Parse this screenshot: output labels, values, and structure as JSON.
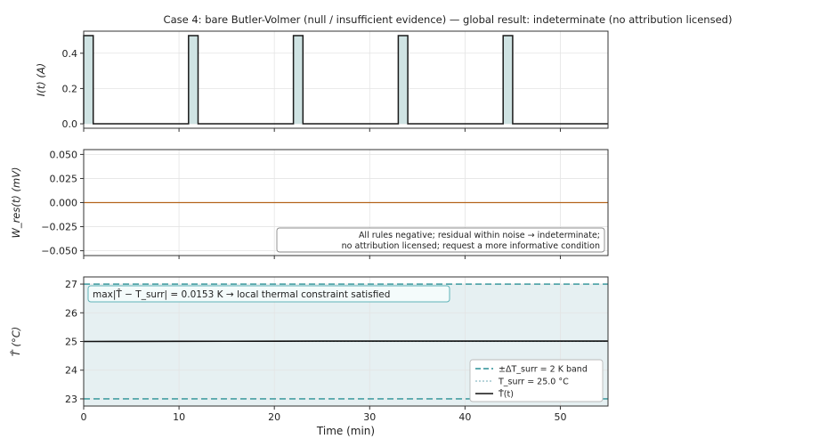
{
  "figure_title": "Case 4: bare Butler-Volmer (null / insufficient evidence)  —  global result: indeterminate (no attribution licensed)",
  "colors": {
    "current_line": "#1a1a1a",
    "current_fill": "#cfe3e3",
    "residual_line": "#b5651d",
    "band_fill": "#e6f0f2",
    "band_edge": "#2a8f95",
    "t_surr_line": "#6fa8b5",
    "temperature_line": "#111111",
    "annotation_edge": "#5fb3b8",
    "annotation_text": "#2a8f95"
  },
  "chart_data": [
    {
      "type": "area",
      "ylabel": "I(t) (A)",
      "xlim": [
        0,
        55
      ],
      "ylim": [
        -0.025,
        0.525
      ],
      "yticks": [
        0.0,
        0.2,
        0.4
      ],
      "ytick_labels": [
        "0.0",
        "0.2",
        "0.4"
      ],
      "xticks": [
        0,
        10,
        20,
        30,
        40,
        50
      ],
      "grid": true,
      "pulses": [
        {
          "start": 0.0,
          "end": 1.0
        },
        {
          "start": 11.0,
          "end": 12.0
        },
        {
          "start": 22.0,
          "end": 23.0
        },
        {
          "start": 33.0,
          "end": 34.0
        },
        {
          "start": 44.0,
          "end": 45.0
        }
      ],
      "pulse_amplitude": 0.5,
      "baseline": 0.0
    },
    {
      "type": "line",
      "ylabel": "W_res(t) (mV)",
      "xlim": [
        0,
        55
      ],
      "ylim": [
        -0.055,
        0.055
      ],
      "yticks": [
        0.05,
        0.025,
        0.0,
        -0.025,
        -0.05
      ],
      "ytick_labels": [
        "0.050",
        "0.025",
        "0.000",
        "−0.025",
        "−0.050"
      ],
      "xticks": [
        0,
        10,
        20,
        30,
        40,
        50
      ],
      "grid": true,
      "series": [
        {
          "x": [
            0,
            55
          ],
          "y": [
            0.0,
            0.0
          ]
        }
      ],
      "annotation": [
        "All rules negative; residual within noise → indeterminate;",
        "no attribution licensed; request a more informative condition"
      ]
    },
    {
      "type": "line",
      "ylabel": "T̂ (°C)",
      "xlabel": "Time (min)",
      "xlim": [
        0,
        55
      ],
      "ylim": [
        22.75,
        27.25
      ],
      "yticks": [
        23,
        24,
        25,
        26,
        27
      ],
      "ytick_labels": [
        "23",
        "24",
        "25",
        "26",
        "27"
      ],
      "xticks": [
        0,
        10,
        20,
        30,
        40,
        50
      ],
      "xtick_labels": [
        "0",
        "10",
        "20",
        "30",
        "40",
        "50"
      ],
      "grid": true,
      "band": [
        23.0,
        27.0
      ],
      "t_surr": 25.0,
      "series": [
        {
          "name": "T̂(t)",
          "x": [
            0,
            5,
            10,
            15,
            20,
            25,
            30,
            35,
            40,
            45,
            50,
            55
          ],
          "y": [
            25.0,
            25.002,
            25.005,
            25.008,
            25.011,
            25.013,
            25.014,
            25.015,
            25.015,
            25.015,
            25.014,
            25.013
          ]
        }
      ],
      "annotation": "max|T̂ − T_surr| = 0.0153 K  →  local thermal constraint satisfied",
      "legend": {
        "placement": "lower-right",
        "entries": [
          "±ΔT_surr = 2 K band",
          "T_surr = 25.0 °C",
          "T̂(t)"
        ]
      }
    }
  ]
}
